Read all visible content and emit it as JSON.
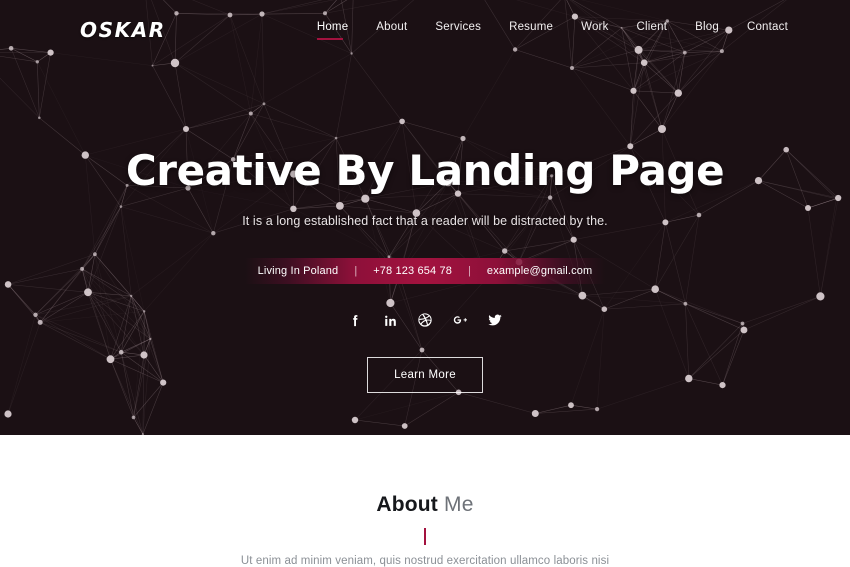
{
  "header": {
    "logo": "OSKAR",
    "nav": [
      {
        "label": "Home",
        "active": true
      },
      {
        "label": "About",
        "active": false
      },
      {
        "label": "Services",
        "active": false
      },
      {
        "label": "Resume",
        "active": false
      },
      {
        "label": "Work",
        "active": false
      },
      {
        "label": "Client",
        "active": false
      },
      {
        "label": "Blog",
        "active": false
      },
      {
        "label": "Contact",
        "active": false
      }
    ]
  },
  "hero": {
    "title": "Creative By Landing Page",
    "subtitle": "It is a long established fact that a reader will be distracted by the.",
    "contact": {
      "location": "Living In Poland",
      "separator": "|",
      "phone": "+78 123 654 78",
      "email": "example@gmail.com"
    },
    "social": [
      {
        "name": "facebook-icon",
        "label": "Facebook"
      },
      {
        "name": "linkedin-icon",
        "label": "LinkedIn"
      },
      {
        "name": "dribbble-icon",
        "label": "Dribbble"
      },
      {
        "name": "googleplus-icon",
        "label": "Google Plus"
      },
      {
        "name": "twitter-icon",
        "label": "Twitter"
      }
    ],
    "cta_label": "Learn More"
  },
  "about": {
    "title_strong": "About",
    "title_light": " Me",
    "subtitle": "Ut enim ad minim veniam, quis nostrud exercitation ullamco laboris nisi"
  },
  "colors": {
    "hero_background": "#1b1014",
    "accent": "#a3123f",
    "accent_bright": "#a3123f",
    "text_light": "#ffffff",
    "about_heading": "#16181c",
    "about_muted": "#8b9096"
  }
}
